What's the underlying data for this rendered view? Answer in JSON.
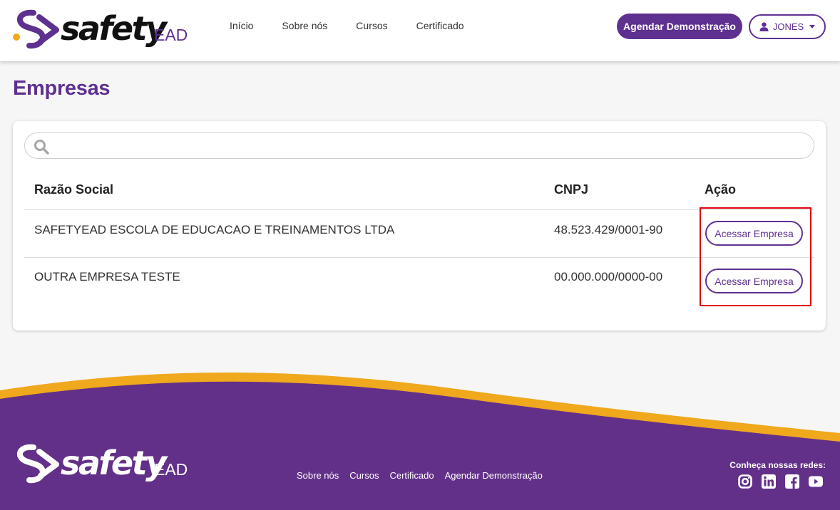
{
  "brand": {
    "name": "safety",
    "suffix": "EAD"
  },
  "nav": [
    {
      "label": "Início"
    },
    {
      "label": "Sobre nós"
    },
    {
      "label": "Cursos"
    },
    {
      "label": "Certificado"
    }
  ],
  "header_actions": {
    "demo_label": "Agendar Demonstração",
    "user_label": "JONES"
  },
  "page": {
    "title": "Empresas"
  },
  "search": {
    "value": "",
    "placeholder": ""
  },
  "table": {
    "columns": [
      "Razão Social",
      "CNPJ",
      "Ação"
    ],
    "rows": [
      {
        "razao_social": "SAFETYEAD ESCOLA DE EDUCACAO E TREINAMENTOS LTDA",
        "cnpj": "48.523.429/0001-90",
        "action_label": "Acessar Empresa"
      },
      {
        "razao_social": "OUTRA EMPRESA TESTE",
        "cnpj": "00.000.000/0000-00",
        "action_label": "Acessar Empresa"
      }
    ]
  },
  "footer": {
    "links": [
      {
        "label": "Sobre nós"
      },
      {
        "label": "Cursos"
      },
      {
        "label": "Certificado"
      },
      {
        "label": "Agendar Demonstração"
      }
    ],
    "social_title": "Conheça nossas redes:",
    "social_icons": [
      "instagram-icon",
      "linkedin-icon",
      "facebook-icon",
      "youtube-icon"
    ]
  },
  "colors": {
    "primary": "#5e3090",
    "accent": "#f0a81c",
    "highlight": "#e0000b",
    "footer_bg": "#623089"
  }
}
